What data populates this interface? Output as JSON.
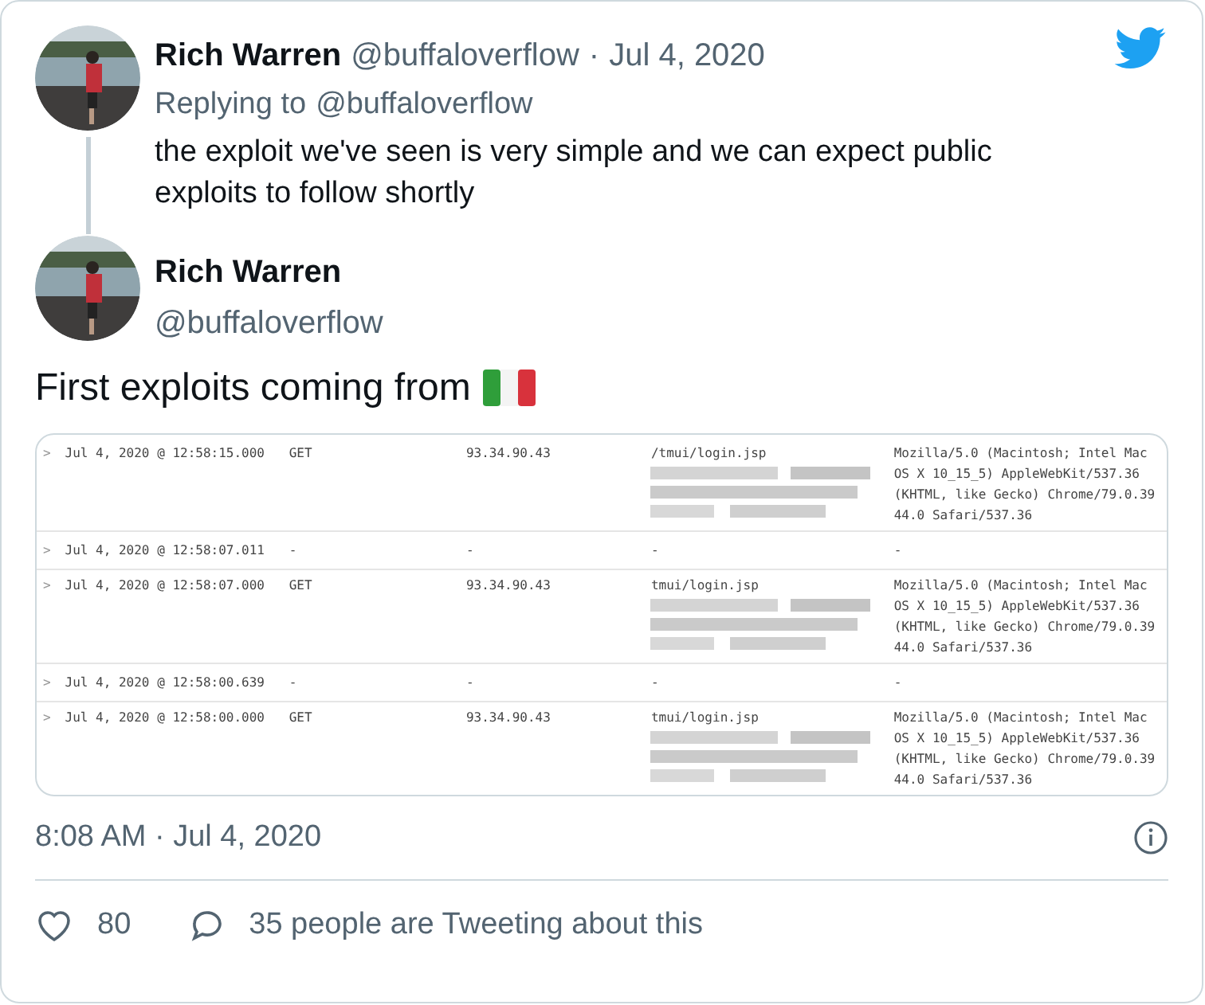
{
  "parent_tweet": {
    "name": "Rich Warren",
    "handle": "@buffaloverflow",
    "separator": "·",
    "date": "Jul 4, 2020",
    "replying_label": "Replying to",
    "replying_handle": "@buffaloverflow",
    "text": "the exploit we've seen is very simple and we can expect public exploits to follow shortly"
  },
  "tweet": {
    "name": "Rich Warren",
    "handle": "@buffaloverflow",
    "text": "First exploits coming from",
    "flag": {
      "kind": "italy"
    }
  },
  "log_table": {
    "rows": [
      {
        "kind": "request",
        "chevron": ">",
        "time": "Jul 4, 2020 @ 12:58:15.000",
        "method": "GET",
        "ip": "93.34.90.43",
        "path": "/tmui/login.jsp",
        "agent": "Mozilla/5.0 (Macintosh; Intel Mac OS X 10_15_5) AppleWebKit/537.36 (KHTML, like Gecko) Chrome/79.0.3944.0 Safari/537.36"
      },
      {
        "kind": "empty",
        "chevron": ">",
        "time": "Jul 4, 2020 @ 12:58:07.011",
        "method": "-",
        "ip": "-",
        "path": "-",
        "agent": "-"
      },
      {
        "kind": "request",
        "chevron": ">",
        "time": "Jul 4, 2020 @ 12:58:07.000",
        "method": "GET",
        "ip": "93.34.90.43",
        "path": "tmui/login.jsp",
        "agent": "Mozilla/5.0 (Macintosh; Intel Mac OS X 10_15_5) AppleWebKit/537.36 (KHTML, like Gecko) Chrome/79.0.3944.0 Safari/537.36"
      },
      {
        "kind": "empty",
        "chevron": ">",
        "time": "Jul 4, 2020 @ 12:58:00.639",
        "method": "-",
        "ip": "-",
        "path": "-",
        "agent": "-"
      },
      {
        "kind": "request",
        "chevron": ">",
        "time": "Jul 4, 2020 @ 12:58:00.000",
        "method": "GET",
        "ip": "93.34.90.43",
        "path": "tmui/login.jsp",
        "agent": "Mozilla/5.0 (Macintosh; Intel Mac OS X 10_15_5) AppleWebKit/537.36 (KHTML, like Gecko) Chrome/79.0.3944.0 Safari/537.36"
      }
    ]
  },
  "timestamp": "8:08 AM · Jul 4, 2020",
  "likes": "80",
  "conversation": "35 people are Tweeting about this"
}
